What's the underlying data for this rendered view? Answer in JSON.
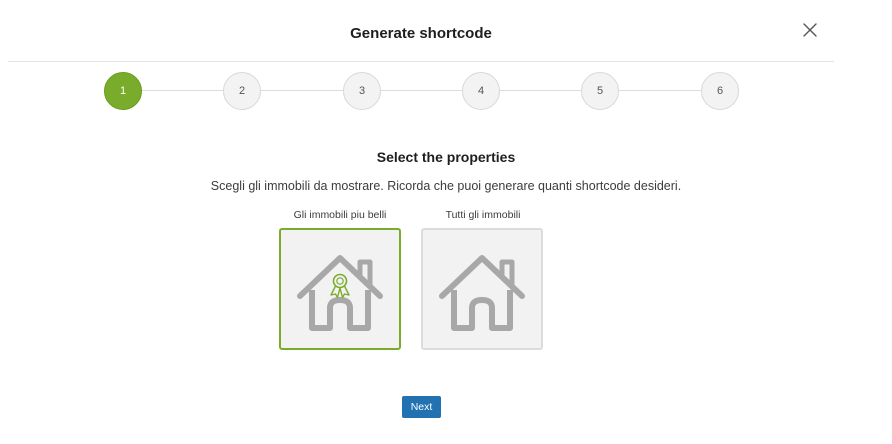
{
  "header": {
    "title": "Generate shortcode",
    "close_icon": "close-icon"
  },
  "stepper": {
    "steps": [
      "1",
      "2",
      "3",
      "4",
      "5",
      "6"
    ],
    "active_step": "1",
    "colors": {
      "active": "#7aac2c",
      "inactive": "#f3f3f3"
    }
  },
  "content": {
    "title": "Select the properties",
    "description": "Scegli gli immobili da mostrare. Ricorda che puoi generare quanti shortcode desideri."
  },
  "options": [
    {
      "label": "Gli immobili piu belli",
      "icon": "house-award-icon",
      "selected": true
    },
    {
      "label": "Tutti gli immobili",
      "icon": "house-icon",
      "selected": false
    }
  ],
  "footer": {
    "next_label": "Next",
    "button_color": "#2271b1"
  }
}
